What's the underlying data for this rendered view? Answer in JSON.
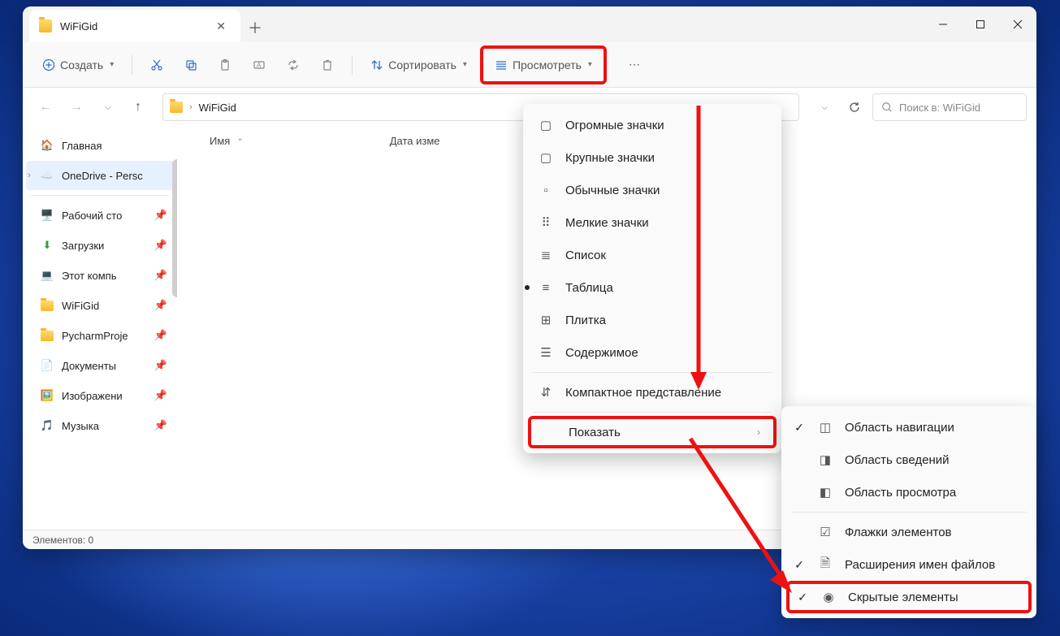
{
  "tab": {
    "title": "WiFiGid"
  },
  "toolbar": {
    "new_label": "Создать",
    "sort_label": "Сортировать",
    "view_label": "Просмотреть"
  },
  "address": {
    "crumb": "WiFiGid"
  },
  "search": {
    "placeholder": "Поиск в: WiFiGid"
  },
  "columns": {
    "name": "Имя",
    "date": "Дата изме"
  },
  "sidebar": {
    "home": "Главная",
    "onedrive": "OneDrive - Persc",
    "pinned": [
      "Рабочий сто",
      "Загрузки",
      "Этот компь",
      "WiFiGid",
      "PycharmProje",
      "Документы",
      "Изображени",
      "Музыка"
    ]
  },
  "view_menu": {
    "items": [
      "Огромные значки",
      "Крупные значки",
      "Обычные значки",
      "Мелкие значки",
      "Список",
      "Таблица",
      "Плитка",
      "Содержимое",
      "Компактное представление",
      "Показать"
    ],
    "selected_index": 5
  },
  "show_menu": {
    "items": [
      "Область навигации",
      "Область сведений",
      "Область просмотра",
      "Флажки элементов",
      "Расширения имен файлов",
      "Скрытые элементы"
    ],
    "checked": [
      true,
      false,
      false,
      false,
      true,
      true
    ]
  },
  "status": {
    "text": "Элементов: 0"
  }
}
